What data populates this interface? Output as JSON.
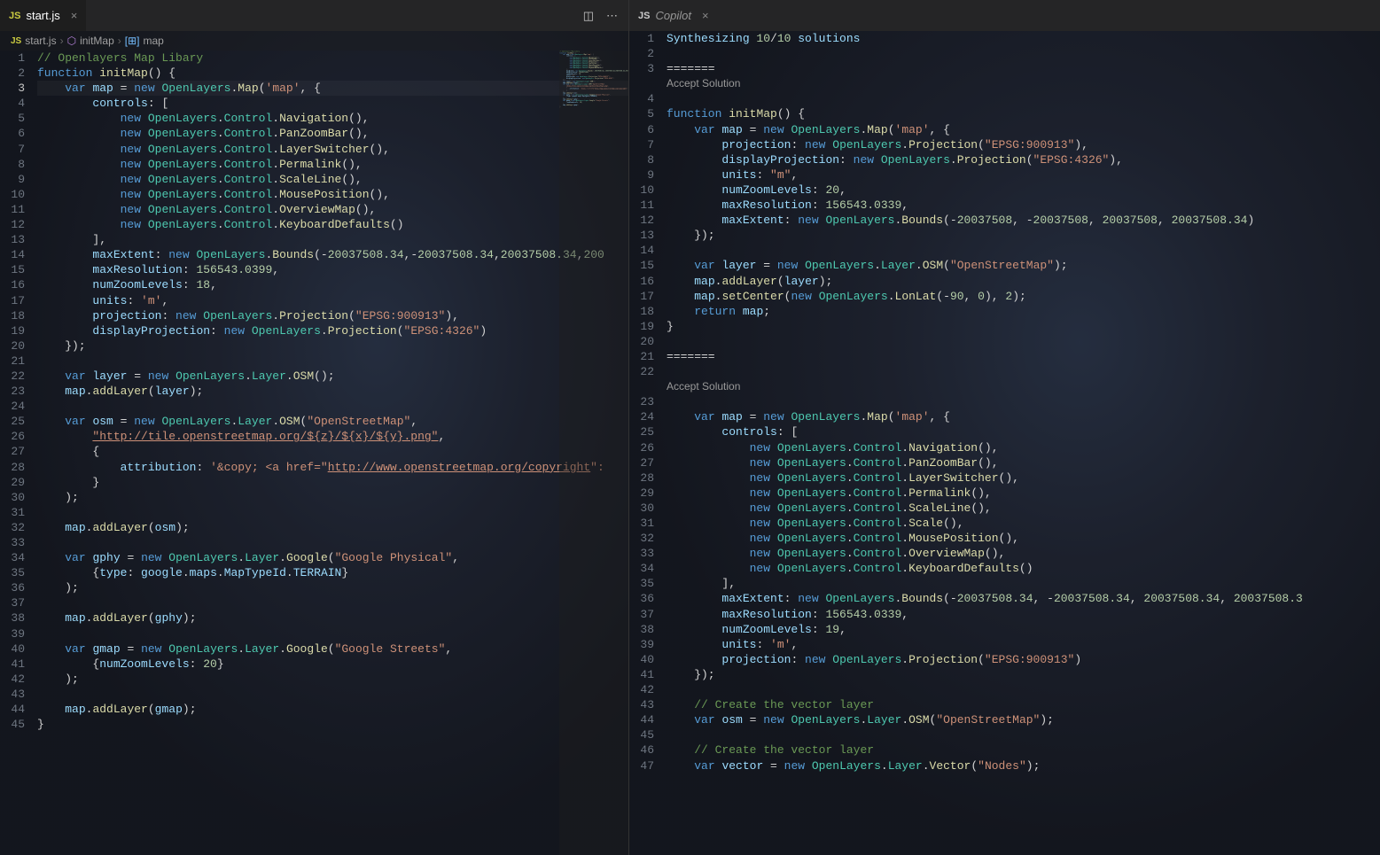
{
  "left": {
    "tab": {
      "icon": "JS",
      "name": "start.js"
    },
    "actions": {
      "split": "◫",
      "more": "⋯"
    },
    "breadcrumbs": {
      "file_icon": "JS",
      "file": "start.js",
      "sym1": "initMap",
      "sym2": "map"
    },
    "lines": [
      {
        "n": 1,
        "html": "<span class='c-comment'>// Openlayers Map Libary</span>"
      },
      {
        "n": 2,
        "html": "<span class='c-keyword'>function</span> <span class='c-func'>initMap</span>() {"
      },
      {
        "n": 3,
        "cur": true,
        "html": "    <span class='c-keyword'>var</span> <span class='c-prop'>map</span> = <span class='c-keyword'>new</span> <span class='c-type'>OpenLayers</span>.<span class='c-func'>Map</span>(<span class='c-string'>'map'</span>, {"
      },
      {
        "n": 4,
        "html": "        <span class='c-prop'>controls</span>: ["
      },
      {
        "n": 5,
        "html": "            <span class='c-keyword'>new</span> <span class='c-type'>OpenLayers</span>.<span class='c-type'>Control</span>.<span class='c-func'>Navigation</span>(),"
      },
      {
        "n": 6,
        "html": "            <span class='c-keyword'>new</span> <span class='c-type'>OpenLayers</span>.<span class='c-type'>Control</span>.<span class='c-func'>PanZoomBar</span>(),"
      },
      {
        "n": 7,
        "html": "            <span class='c-keyword'>new</span> <span class='c-type'>OpenLayers</span>.<span class='c-type'>Control</span>.<span class='c-func'>LayerSwitcher</span>(),"
      },
      {
        "n": 8,
        "html": "            <span class='c-keyword'>new</span> <span class='c-type'>OpenLayers</span>.<span class='c-type'>Control</span>.<span class='c-func'>Permalink</span>(),"
      },
      {
        "n": 9,
        "html": "            <span class='c-keyword'>new</span> <span class='c-type'>OpenLayers</span>.<span class='c-type'>Control</span>.<span class='c-func'>ScaleLine</span>(),"
      },
      {
        "n": 10,
        "html": "            <span class='c-keyword'>new</span> <span class='c-type'>OpenLayers</span>.<span class='c-type'>Control</span>.<span class='c-func'>MousePosition</span>(),"
      },
      {
        "n": 11,
        "html": "            <span class='c-keyword'>new</span> <span class='c-type'>OpenLayers</span>.<span class='c-type'>Control</span>.<span class='c-func'>OverviewMap</span>(),"
      },
      {
        "n": 12,
        "html": "            <span class='c-keyword'>new</span> <span class='c-type'>OpenLayers</span>.<span class='c-type'>Control</span>.<span class='c-func'>KeyboardDefaults</span>()"
      },
      {
        "n": 13,
        "html": "        ],"
      },
      {
        "n": 14,
        "html": "        <span class='c-prop'>maxExtent</span>: <span class='c-keyword'>new</span> <span class='c-type'>OpenLayers</span>.<span class='c-func'>Bounds</span>(-<span class='c-number'>20037508.34</span>,-<span class='c-number'>20037508.34</span>,<span class='c-number'>20037508.34</span>,<span class='c-number'>200</span>"
      },
      {
        "n": 15,
        "html": "        <span class='c-prop'>maxResolution</span>: <span class='c-number'>156543.0399</span>,"
      },
      {
        "n": 16,
        "html": "        <span class='c-prop'>numZoomLevels</span>: <span class='c-number'>18</span>,"
      },
      {
        "n": 17,
        "html": "        <span class='c-prop'>units</span>: <span class='c-string'>'m'</span>,"
      },
      {
        "n": 18,
        "html": "        <span class='c-prop'>projection</span>: <span class='c-keyword'>new</span> <span class='c-type'>OpenLayers</span>.<span class='c-func'>Projection</span>(<span class='c-string'>\"EPSG:900913\"</span>),"
      },
      {
        "n": 19,
        "html": "        <span class='c-prop'>displayProjection</span>: <span class='c-keyword'>new</span> <span class='c-type'>OpenLayers</span>.<span class='c-func'>Projection</span>(<span class='c-string'>\"EPSG:4326\"</span>)"
      },
      {
        "n": 20,
        "html": "    });"
      },
      {
        "n": 21,
        "html": ""
      },
      {
        "n": 22,
        "html": "    <span class='c-keyword'>var</span> <span class='c-prop'>layer</span> = <span class='c-keyword'>new</span> <span class='c-type'>OpenLayers</span>.<span class='c-type'>Layer</span>.<span class='c-func'>OSM</span>();"
      },
      {
        "n": 23,
        "html": "    <span class='c-prop'>map</span>.<span class='c-func'>addLayer</span>(<span class='c-prop'>layer</span>);"
      },
      {
        "n": 24,
        "html": ""
      },
      {
        "n": 25,
        "html": "    <span class='c-keyword'>var</span> <span class='c-prop'>osm</span> = <span class='c-keyword'>new</span> <span class='c-type'>OpenLayers</span>.<span class='c-type'>Layer</span>.<span class='c-func'>OSM</span>(<span class='c-string'>\"OpenStreetMap\"</span>,"
      },
      {
        "n": 26,
        "html": "        <span class='c-url'>\"http://tile.openstreetmap.org/${z}/${x}/${y}.png\"</span>,"
      },
      {
        "n": 27,
        "html": "        {"
      },
      {
        "n": 28,
        "html": "            <span class='c-prop'>attribution</span>: <span class='c-string'>'&amp;copy; &lt;a href=\"</span><span class='c-url'>http://www.openstreetmap.org/copyright</span><span class='c-string'>\":</span>"
      },
      {
        "n": 29,
        "html": "        }"
      },
      {
        "n": 30,
        "html": "    );"
      },
      {
        "n": 31,
        "html": ""
      },
      {
        "n": 32,
        "html": "    <span class='c-prop'>map</span>.<span class='c-func'>addLayer</span>(<span class='c-prop'>osm</span>);"
      },
      {
        "n": 33,
        "html": ""
      },
      {
        "n": 34,
        "html": "    <span class='c-keyword'>var</span> <span class='c-prop'>gphy</span> = <span class='c-keyword'>new</span> <span class='c-type'>OpenLayers</span>.<span class='c-type'>Layer</span>.<span class='c-func'>Google</span>(<span class='c-string'>\"Google Physical\"</span>,"
      },
      {
        "n": 35,
        "html": "        {<span class='c-prop'>type</span>: <span class='c-prop'>google</span>.<span class='c-prop'>maps</span>.<span class='c-prop'>MapTypeId</span>.<span class='c-prop'>TERRAIN</span>}"
      },
      {
        "n": 36,
        "html": "    );"
      },
      {
        "n": 37,
        "html": ""
      },
      {
        "n": 38,
        "html": "    <span class='c-prop'>map</span>.<span class='c-func'>addLayer</span>(<span class='c-prop'>gphy</span>);"
      },
      {
        "n": 39,
        "html": ""
      },
      {
        "n": 40,
        "html": "    <span class='c-keyword'>var</span> <span class='c-prop'>gmap</span> = <span class='c-keyword'>new</span> <span class='c-type'>OpenLayers</span>.<span class='c-type'>Layer</span>.<span class='c-func'>Google</span>(<span class='c-string'>\"Google Streets\"</span>,"
      },
      {
        "n": 41,
        "html": "        {<span class='c-prop'>numZoomLevels</span>: <span class='c-number'>20</span>}"
      },
      {
        "n": 42,
        "html": "    );"
      },
      {
        "n": 43,
        "html": ""
      },
      {
        "n": 44,
        "html": "    <span class='c-prop'>map</span>.<span class='c-func'>addLayer</span>(<span class='c-prop'>gmap</span>);"
      },
      {
        "n": 45,
        "html": "}"
      }
    ]
  },
  "right": {
    "tab": {
      "icon": "JS",
      "name": "Copilot"
    },
    "codelens1": "Accept Solution",
    "codelens2": "Accept Solution",
    "lines": [
      {
        "n": 1,
        "html": "<span class='c-prop'>Synthesizing </span><span class='c-number'>10</span>/<span class='c-number'>10</span><span class='c-prop'> solutions</span>"
      },
      {
        "n": 2,
        "html": ""
      },
      {
        "n": 3,
        "html": "<span class='c-punct'>=======</span>"
      },
      {
        "n": 4,
        "lens": 1,
        "html": ""
      },
      {
        "n": 5,
        "html": "<span class='c-keyword'>function</span> <span class='c-func'>initMap</span>() {"
      },
      {
        "n": 6,
        "html": "    <span class='c-keyword'>var</span> <span class='c-prop'>map</span> = <span class='c-keyword'>new</span> <span class='c-type'>OpenLayers</span>.<span class='c-func'>Map</span>(<span class='c-string'>'map'</span>, {"
      },
      {
        "n": 7,
        "html": "        <span class='c-prop'>projection</span>: <span class='c-keyword'>new</span> <span class='c-type'>OpenLayers</span>.<span class='c-func'>Projection</span>(<span class='c-string'>\"EPSG:900913\"</span>),"
      },
      {
        "n": 8,
        "html": "        <span class='c-prop'>displayProjection</span>: <span class='c-keyword'>new</span> <span class='c-type'>OpenLayers</span>.<span class='c-func'>Projection</span>(<span class='c-string'>\"EPSG:4326\"</span>),"
      },
      {
        "n": 9,
        "html": "        <span class='c-prop'>units</span>: <span class='c-string'>\"m\"</span>,"
      },
      {
        "n": 10,
        "html": "        <span class='c-prop'>numZoomLevels</span>: <span class='c-number'>20</span>,"
      },
      {
        "n": 11,
        "html": "        <span class='c-prop'>maxResolution</span>: <span class='c-number'>156543.0339</span>,"
      },
      {
        "n": 12,
        "html": "        <span class='c-prop'>maxExtent</span>: <span class='c-keyword'>new</span> <span class='c-type'>OpenLayers</span>.<span class='c-func'>Bounds</span>(-<span class='c-number'>20037508</span>, -<span class='c-number'>20037508</span>, <span class='c-number'>20037508</span>, <span class='c-number'>20037508.34</span>)"
      },
      {
        "n": 13,
        "html": "    });"
      },
      {
        "n": 14,
        "html": ""
      },
      {
        "n": 15,
        "html": "    <span class='c-keyword'>var</span> <span class='c-prop'>layer</span> = <span class='c-keyword'>new</span> <span class='c-type'>OpenLayers</span>.<span class='c-type'>Layer</span>.<span class='c-func'>OSM</span>(<span class='c-string'>\"OpenStreetMap\"</span>);"
      },
      {
        "n": 16,
        "html": "    <span class='c-prop'>map</span>.<span class='c-func'>addLayer</span>(<span class='c-prop'>layer</span>);"
      },
      {
        "n": 17,
        "html": "    <span class='c-prop'>map</span>.<span class='c-func'>setCenter</span>(<span class='c-keyword'>new</span> <span class='c-type'>OpenLayers</span>.<span class='c-func'>LonLat</span>(-<span class='c-number'>90</span>, <span class='c-number'>0</span>), <span class='c-number'>2</span>);"
      },
      {
        "n": 18,
        "html": "    <span class='c-keyword'>return</span> <span class='c-prop'>map</span>;"
      },
      {
        "n": 19,
        "html": "}"
      },
      {
        "n": 20,
        "html": ""
      },
      {
        "n": 21,
        "html": "<span class='c-punct'>=======</span>"
      },
      {
        "n": 22,
        "html": ""
      },
      {
        "n": 23,
        "lens": 2,
        "html": ""
      },
      {
        "n": 24,
        "html": "    <span class='c-keyword'>var</span> <span class='c-prop'>map</span> = <span class='c-keyword'>new</span> <span class='c-type'>OpenLayers</span>.<span class='c-func'>Map</span>(<span class='c-string'>'map'</span>, {"
      },
      {
        "n": 25,
        "html": "        <span class='c-prop'>controls</span>: ["
      },
      {
        "n": 26,
        "html": "            <span class='c-keyword'>new</span> <span class='c-type'>OpenLayers</span>.<span class='c-type'>Control</span>.<span class='c-func'>Navigation</span>(),"
      },
      {
        "n": 27,
        "html": "            <span class='c-keyword'>new</span> <span class='c-type'>OpenLayers</span>.<span class='c-type'>Control</span>.<span class='c-func'>PanZoomBar</span>(),"
      },
      {
        "n": 28,
        "html": "            <span class='c-keyword'>new</span> <span class='c-type'>OpenLayers</span>.<span class='c-type'>Control</span>.<span class='c-func'>LayerSwitcher</span>(),"
      },
      {
        "n": 29,
        "html": "            <span class='c-keyword'>new</span> <span class='c-type'>OpenLayers</span>.<span class='c-type'>Control</span>.<span class='c-func'>Permalink</span>(),"
      },
      {
        "n": 30,
        "html": "            <span class='c-keyword'>new</span> <span class='c-type'>OpenLayers</span>.<span class='c-type'>Control</span>.<span class='c-func'>ScaleLine</span>(),"
      },
      {
        "n": 31,
        "html": "            <span class='c-keyword'>new</span> <span class='c-type'>OpenLayers</span>.<span class='c-type'>Control</span>.<span class='c-func'>Scale</span>(),"
      },
      {
        "n": 32,
        "html": "            <span class='c-keyword'>new</span> <span class='c-type'>OpenLayers</span>.<span class='c-type'>Control</span>.<span class='c-func'>MousePosition</span>(),"
      },
      {
        "n": 33,
        "html": "            <span class='c-keyword'>new</span> <span class='c-type'>OpenLayers</span>.<span class='c-type'>Control</span>.<span class='c-func'>OverviewMap</span>(),"
      },
      {
        "n": 34,
        "html": "            <span class='c-keyword'>new</span> <span class='c-type'>OpenLayers</span>.<span class='c-type'>Control</span>.<span class='c-func'>KeyboardDefaults</span>()"
      },
      {
        "n": 35,
        "html": "        ],"
      },
      {
        "n": 36,
        "html": "        <span class='c-prop'>maxExtent</span>: <span class='c-keyword'>new</span> <span class='c-type'>OpenLayers</span>.<span class='c-func'>Bounds</span>(-<span class='c-number'>20037508.34</span>, -<span class='c-number'>20037508.34</span>, <span class='c-number'>20037508.34</span>, <span class='c-number'>20037508.3</span>"
      },
      {
        "n": 37,
        "html": "        <span class='c-prop'>maxResolution</span>: <span class='c-number'>156543.0339</span>,"
      },
      {
        "n": 38,
        "html": "        <span class='c-prop'>numZoomLevels</span>: <span class='c-number'>19</span>,"
      },
      {
        "n": 39,
        "html": "        <span class='c-prop'>units</span>: <span class='c-string'>'m'</span>,"
      },
      {
        "n": 40,
        "html": "        <span class='c-prop'>projection</span>: <span class='c-keyword'>new</span> <span class='c-type'>OpenLayers</span>.<span class='c-func'>Projection</span>(<span class='c-string'>\"EPSG:900913\"</span>)"
      },
      {
        "n": 41,
        "html": "    });"
      },
      {
        "n": 42,
        "html": ""
      },
      {
        "n": 43,
        "html": "    <span class='c-comment'>// Create the vector layer</span>"
      },
      {
        "n": 44,
        "html": "    <span class='c-keyword'>var</span> <span class='c-prop'>osm</span> = <span class='c-keyword'>new</span> <span class='c-type'>OpenLayers</span>.<span class='c-type'>Layer</span>.<span class='c-func'>OSM</span>(<span class='c-string'>\"OpenStreetMap\"</span>);"
      },
      {
        "n": 45,
        "html": ""
      },
      {
        "n": 46,
        "html": "    <span class='c-comment'>// Create the vector layer</span>"
      },
      {
        "n": 47,
        "html": "    <span class='c-keyword'>var</span> <span class='c-prop'>vector</span> = <span class='c-keyword'>new</span> <span class='c-type'>OpenLayers</span>.<span class='c-type'>Layer</span>.<span class='c-func'>Vector</span>(<span class='c-string'>\"Nodes\"</span>);"
      }
    ]
  }
}
